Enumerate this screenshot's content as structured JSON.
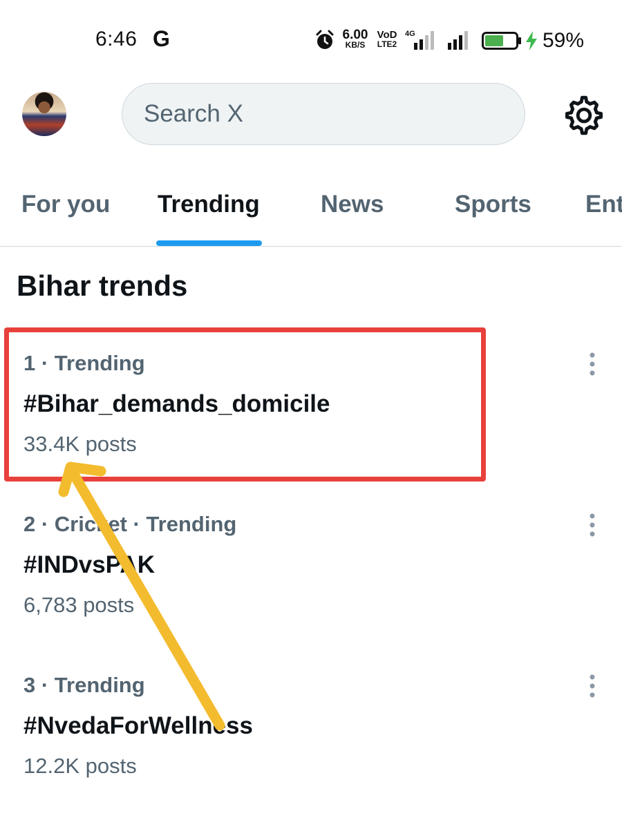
{
  "status_bar": {
    "time": "6:46",
    "carrier_icon_text": "G",
    "net_speed_value": "6.00",
    "net_speed_unit": "KB/S",
    "volte_top": "VoD",
    "volte_bottom": "LTE2",
    "network_type": "4G",
    "battery_percent": "59%",
    "battery_level": 0.59,
    "icons": [
      "alarm-icon",
      "signal-icon",
      "battery-icon",
      "charging-icon"
    ]
  },
  "header": {
    "search_placeholder": "Search X",
    "settings_icon": "gear-icon"
  },
  "tabs": [
    {
      "label": "For you",
      "active": false
    },
    {
      "label": "Trending",
      "active": true
    },
    {
      "label": "News",
      "active": false
    },
    {
      "label": "Sports",
      "active": false
    },
    {
      "label": "Ent",
      "active": false
    }
  ],
  "section_title": "Bihar trends",
  "trends": [
    {
      "meta": "1 · Trending",
      "name": "#Bihar_demands_domicile",
      "posts": "33.4K posts",
      "highlighted": true
    },
    {
      "meta": "2 · Cricket · Trending",
      "name": "#INDvsPAK",
      "posts": "6,783 posts",
      "highlighted": false
    },
    {
      "meta": "3 · Trending",
      "name": "#NvedaForWellness",
      "posts": "12.2K posts",
      "highlighted": false
    }
  ],
  "colors": {
    "accent": "#1d9bf0",
    "highlight_border": "#e8413c",
    "annotation_arrow": "#f3bb2e",
    "battery_fill": "#4caf50",
    "charging_bolt": "#3fb94f",
    "secondary_text": "#536471",
    "primary_text": "#0f1419"
  }
}
